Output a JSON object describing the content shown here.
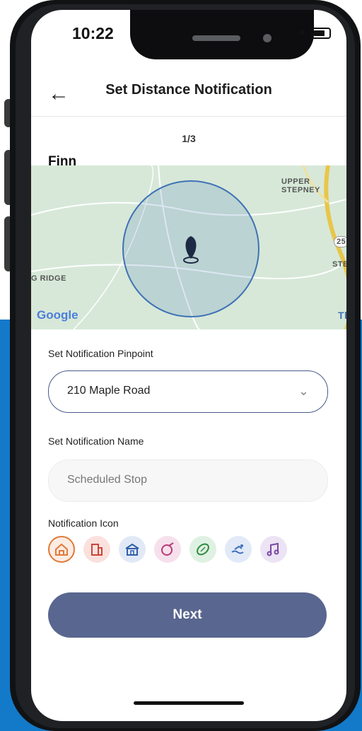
{
  "status_bar": {
    "time": "10:22"
  },
  "header": {
    "title": "Set Distance Notification",
    "back_icon": "arrow-left-icon"
  },
  "step": {
    "label": "1/3"
  },
  "person": {
    "name": "Finn"
  },
  "map": {
    "labels": {
      "upper_stepney": "UPPER STEPNEY",
      "ridge": "G RIDGE",
      "road_number": "25",
      "ste": "STE",
      "th": "Th"
    },
    "attribution": "Google",
    "pin_icon": "map-pin-icon"
  },
  "pinpoint": {
    "label": "Set Notification Pinpoint",
    "selected": "210 Maple Road"
  },
  "name_field": {
    "label": "Set Notification Name",
    "placeholder": "Scheduled Stop"
  },
  "icon_picker": {
    "label": "Notification Icon",
    "icons": [
      {
        "name": "home-icon",
        "color": "#e07a3b"
      },
      {
        "name": "building-icon",
        "color": "#c9463a"
      },
      {
        "name": "school-icon",
        "color": "#2f5fa8"
      },
      {
        "name": "paint-icon",
        "color": "#b83a78"
      },
      {
        "name": "football-icon",
        "color": "#2e8a3e"
      },
      {
        "name": "swim-icon",
        "color": "#3d6fbf"
      },
      {
        "name": "music-icon",
        "color": "#7a4aa3"
      }
    ]
  },
  "next_button": {
    "label": "Next"
  }
}
